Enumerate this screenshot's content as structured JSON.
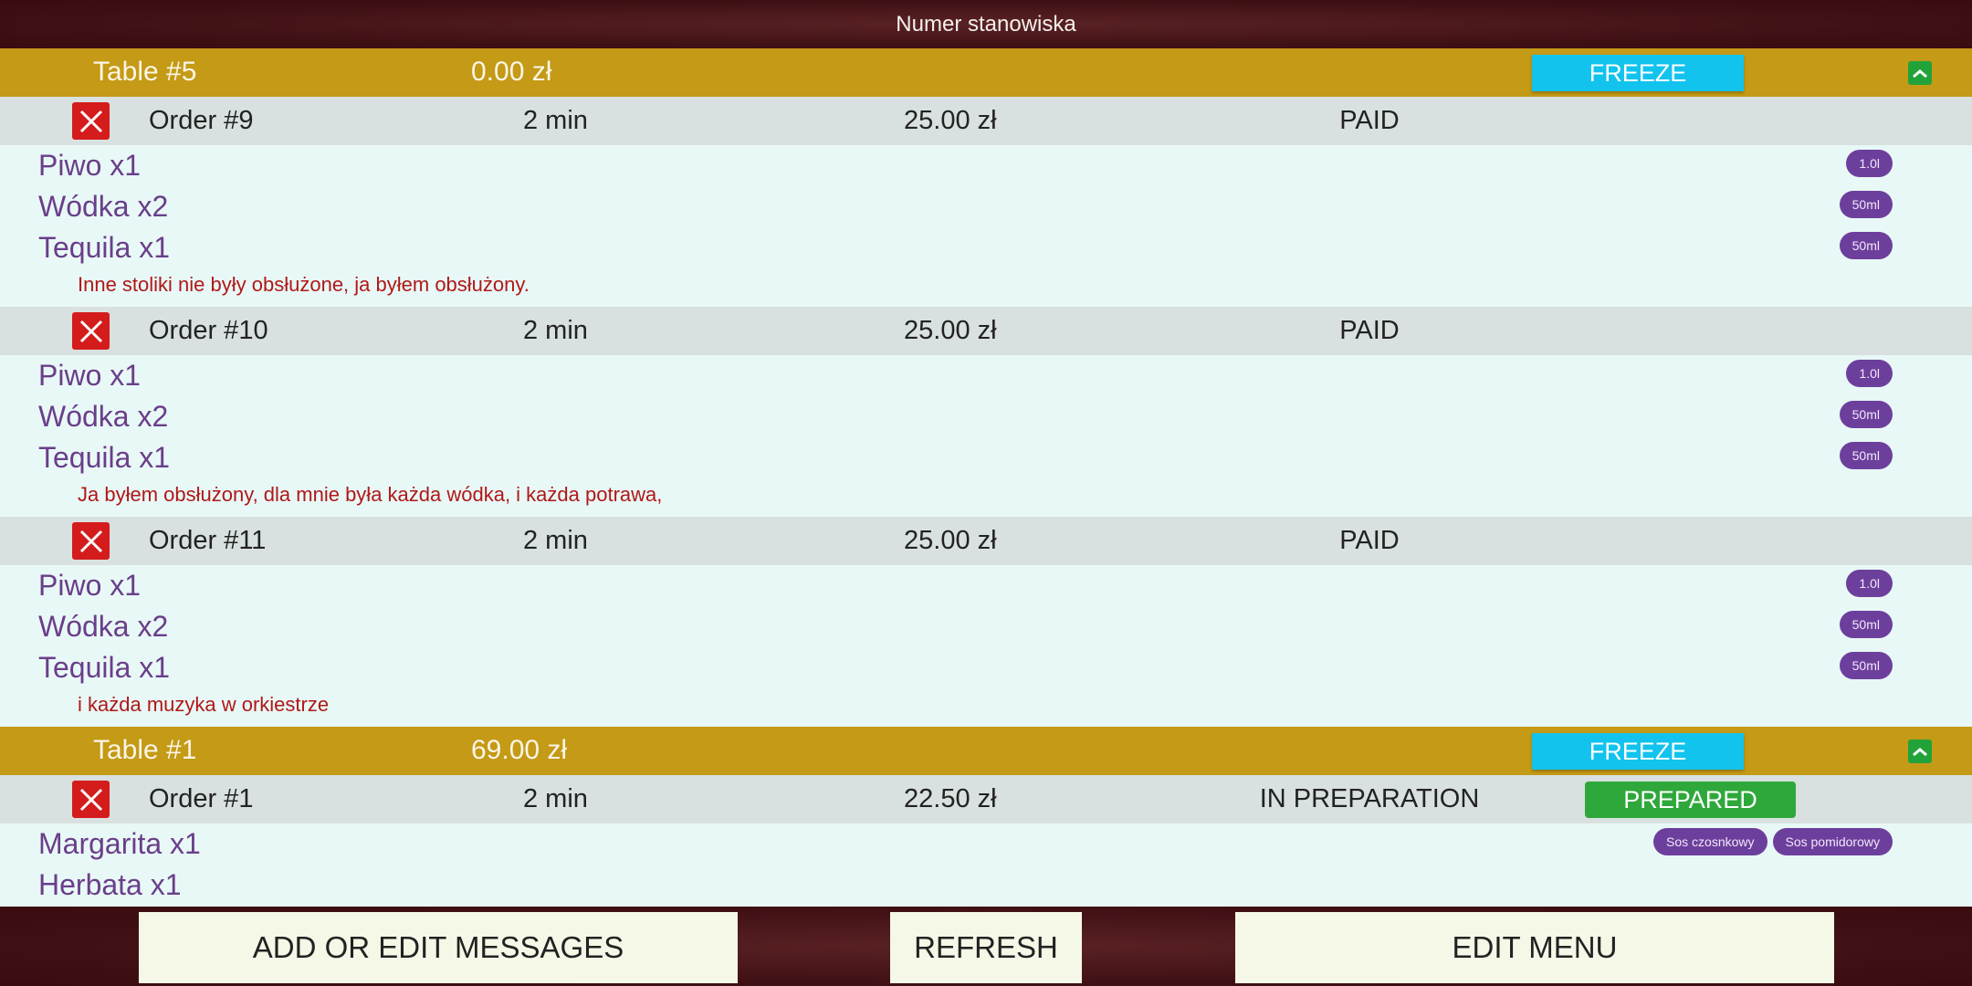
{
  "header": {
    "title": "Numer stanowiska"
  },
  "tables": [
    {
      "name": "Table #5",
      "total": "0.00 zł",
      "freeze_label": "FREEZE",
      "orders": [
        {
          "name": "Order #9",
          "time": "2 min",
          "price": "25.00 zł",
          "status": "PAID",
          "items": [
            {
              "name": "Piwo x1",
              "tags": [
                "1.0l"
              ]
            },
            {
              "name": "Wódka x2",
              "tags": [
                "50ml"
              ]
            },
            {
              "name": "Tequila x1",
              "tags": [
                "50ml"
              ]
            }
          ],
          "message": "Inne stoliki nie były obsłużone, ja byłem obsłużony."
        },
        {
          "name": "Order #10",
          "time": "2 min",
          "price": "25.00 zł",
          "status": "PAID",
          "items": [
            {
              "name": "Piwo x1",
              "tags": [
                "1.0l"
              ]
            },
            {
              "name": "Wódka x2",
              "tags": [
                "50ml"
              ]
            },
            {
              "name": "Tequila x1",
              "tags": [
                "50ml"
              ]
            }
          ],
          "message": "Ja byłem obsłużony, dla mnie była każda wódka, i każda potrawa,"
        },
        {
          "name": "Order #11",
          "time": "2 min",
          "price": "25.00 zł",
          "status": "PAID",
          "items": [
            {
              "name": "Piwo x1",
              "tags": [
                "1.0l"
              ]
            },
            {
              "name": "Wódka x2",
              "tags": [
                "50ml"
              ]
            },
            {
              "name": "Tequila x1",
              "tags": [
                "50ml"
              ]
            }
          ],
          "message": "i każda muzyka w orkiestrze"
        }
      ]
    },
    {
      "name": "Table #1",
      "total": "69.00 zł",
      "freeze_label": "FREEZE",
      "orders": [
        {
          "name": "Order #1",
          "time": "2 min",
          "price": "22.50 zł",
          "status": "IN PREPARATION",
          "action_label": "PREPARED",
          "items": [
            {
              "name": "Margarita x1",
              "tags": [
                "Sos czosnkowy",
                "Sos pomidorowy"
              ]
            },
            {
              "name": "Herbata x1",
              "tags": []
            }
          ]
        }
      ]
    }
  ],
  "footer": {
    "messages_label": "ADD OR EDIT MESSAGES",
    "refresh_label": "REFRESH",
    "menu_label": "EDIT MENU"
  },
  "colors": {
    "topbar": "#3e0f13",
    "table_bar": "#c49a16",
    "freeze": "#12c3ee",
    "prepared": "#2fa83b",
    "delete": "#d51c1c",
    "item_text": "#6a3e8a",
    "message_text": "#b01818",
    "chip": "#6d3f9c"
  }
}
